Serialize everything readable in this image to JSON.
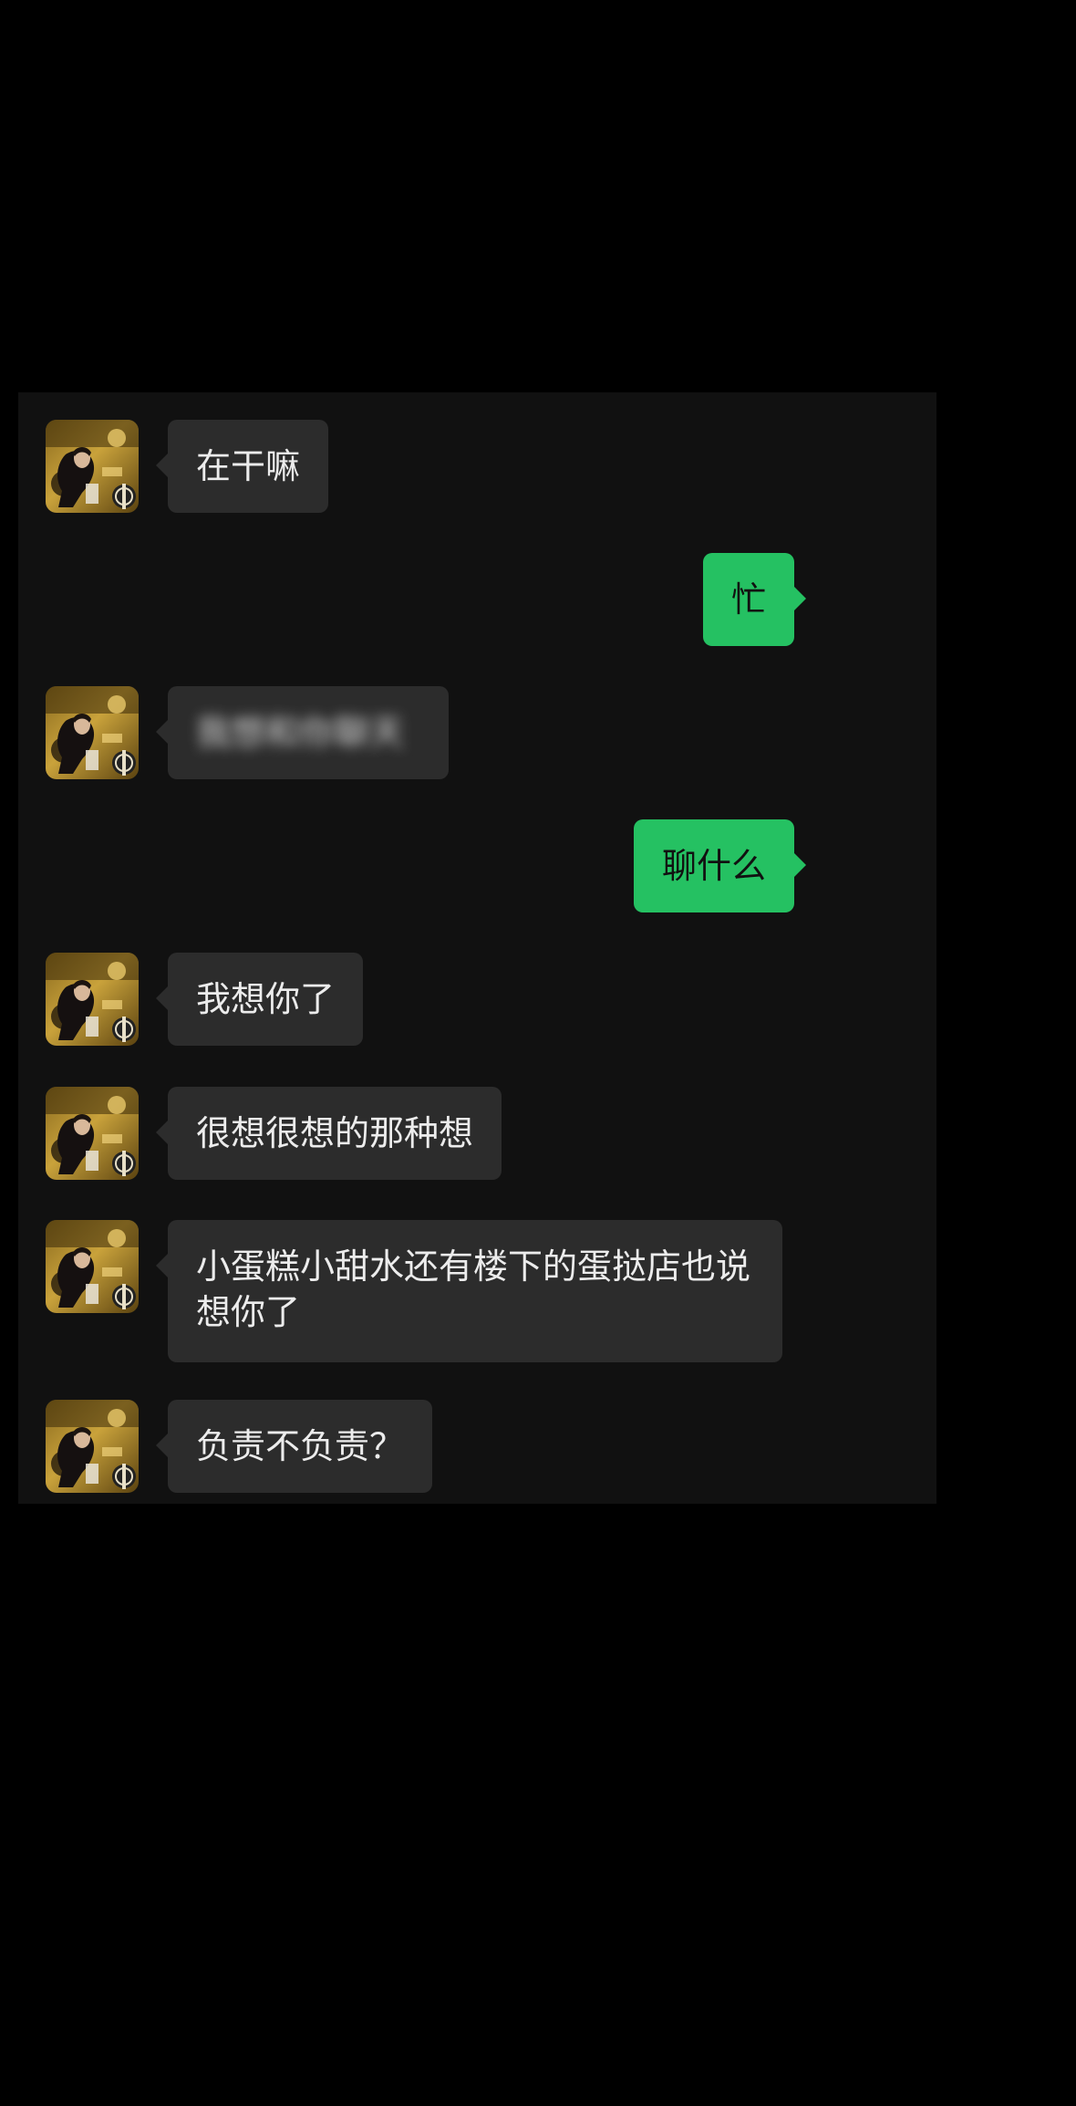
{
  "colors": {
    "page_background": "#000000",
    "chat_background": "#111111",
    "incoming_bubble": "#2c2c2c",
    "outgoing_bubble": "#25c162",
    "incoming_text": "#ececec",
    "outgoing_text": "#111111"
  },
  "contact": {
    "avatar_icon": "contact-avatar-photo"
  },
  "messages": [
    {
      "direction": "incoming",
      "text": "在干嘛"
    },
    {
      "direction": "outgoing",
      "text": "忙"
    },
    {
      "direction": "incoming",
      "text": "我想和你聊天",
      "obscured": true
    },
    {
      "direction": "outgoing",
      "text": "聊什么"
    },
    {
      "direction": "incoming",
      "text": "我想你了"
    },
    {
      "direction": "incoming",
      "text": "很想很想的那种想"
    },
    {
      "direction": "incoming",
      "text": "小蛋糕小甜水还有楼下的蛋挞店也说想你了"
    },
    {
      "direction": "incoming",
      "text": "负责不负责？"
    }
  ]
}
